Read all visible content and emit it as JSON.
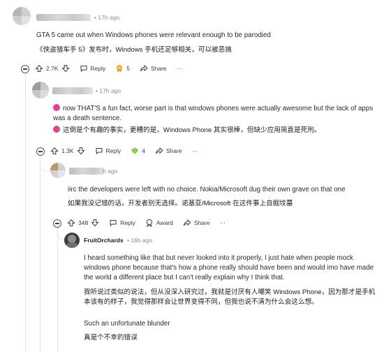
{
  "comments": [
    {
      "time": "• 17h ago",
      "text_en": "GTA 5 came out when Windows phones were relevant enough to be parodied",
      "text_zh": "《侠盗猎车手 5》发布时，Windows 手机还足够相关，可以被恶搞",
      "votes": "2.7K",
      "reply_label": "Reply",
      "award_count": "5",
      "share_label": "Share",
      "more_label": "···"
    },
    {
      "time": "• 17h ago",
      "text_en": "now THAT'S a fun fact, worse part is that windows phones were actually awesome but the lack of apps was a death sentence.",
      "text_zh": "这倒是个有趣的事实，更糟的是，Windows Phone 其实很棒，但缺少应用简直是死刑。",
      "votes": "1.3K",
      "reply_label": "Reply",
      "award_count": "4",
      "share_label": "Share",
      "more_label": "···"
    },
    {
      "time": "h ago",
      "text_en": "iirc the developers were left with no choice. Nokia/Microsoft dug their own grave on that one",
      "text_zh": "如果我没记错的话，开发者别无选择。诺基亚/Microsoft 在这件事上自掘坟墓",
      "votes": "348",
      "reply_label": "Reply",
      "award_label": "Award",
      "share_label": "Share",
      "more_label": "···"
    },
    {
      "username": "FruitOrchards",
      "time": "• 16h ago",
      "text_en": "I heard something like that but never looked into it properly, I just hate when people mock windows phone because that's how a phone really should have been and would imo have made the world a different place but I can't really explain why I think that.",
      "text_zh": "我听说过类似的说法，但从没深入研究过，我就是讨厌有人嘲笑 Windows Phone，因为那才是手机本该有的样子，我觉得那样会让世界变得不同，但我也说不清为什么会这么想。",
      "text_en_2": "Such an unfortunate blunder",
      "text_zh_2": "真是个不幸的错误"
    }
  ],
  "colors": {
    "thread_line": "#e5e5e5",
    "meta": "#8a8a8a",
    "award_orange": "#f5a623",
    "award_green": "#6dbf3a",
    "fun_fact_emoji": "#e2438a"
  },
  "icons": [
    "upvote-icon",
    "downvote-icon",
    "reply-icon",
    "award-icon",
    "share-icon",
    "more-icon",
    "collapse-icon"
  ]
}
